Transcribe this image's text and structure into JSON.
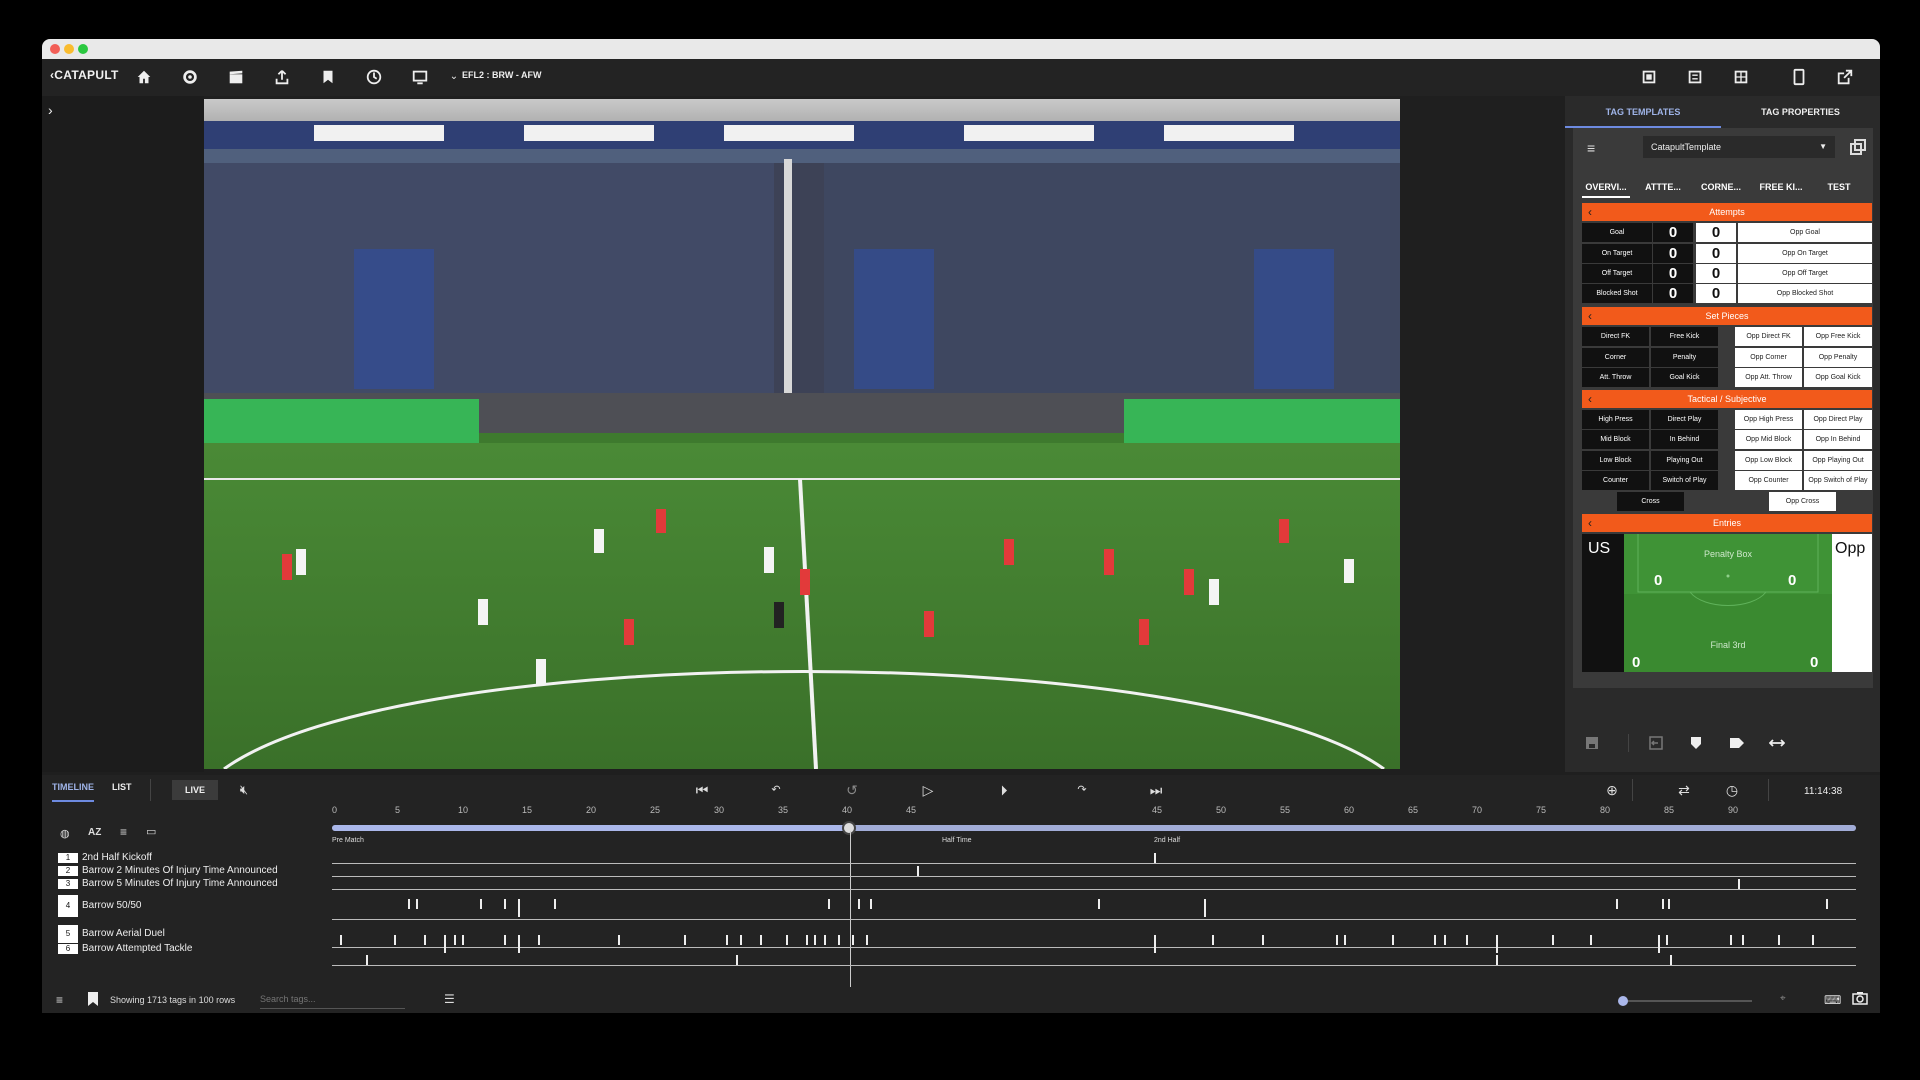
{
  "toolbar": {
    "logo": "CATAPULT",
    "match": "EFL2 : BRW - AFW",
    "icons": [
      "home-icon",
      "gear-icon",
      "clapper-icon",
      "upload-icon",
      "bookmark-icon",
      "clock-icon",
      "monitor-icon"
    ]
  },
  "right_panel": {
    "tabs": [
      "TAG TEMPLATES",
      "TAG PROPERTIES"
    ],
    "template_select": "CatapultTemplate",
    "subtabs": [
      "OVERVI...",
      "ATTTE...",
      "CORNE...",
      "FREE KI...",
      "TEST"
    ],
    "sections": {
      "attempts": "Attempts",
      "set_pieces": "Set Pieces",
      "tactical": "Tactical / Subjective",
      "entries": "Entries"
    },
    "attempts_rows": [
      {
        "label": "Goal",
        "us": "0",
        "opp": "0",
        "opp_label": "Opp Goal"
      },
      {
        "label": "On Target",
        "us": "0",
        "opp": "0",
        "opp_label": "Opp On Target"
      },
      {
        "label": "Off Target",
        "us": "0",
        "opp": "0",
        "opp_label": "Opp Off Target"
      },
      {
        "label": "Blocked Shot",
        "us": "0",
        "opp": "0",
        "opp_label": "Opp Blocked Shot"
      }
    ],
    "set_pieces_rows": [
      [
        "Direct FK",
        "Free Kick",
        "Opp Direct FK",
        "Opp Free Kick"
      ],
      [
        "Corner",
        "Penalty",
        "Opp Corner",
        "Opp Penalty"
      ],
      [
        "Att. Throw",
        "Goal Kick",
        "Opp Att. Throw",
        "Opp Goal Kick"
      ]
    ],
    "tactical_rows": [
      [
        "High Press",
        "Direct Play",
        "Opp High Press",
        "Opp Direct Play"
      ],
      [
        "Mid Block",
        "In Behind",
        "Opp Mid Block",
        "Opp In Behind"
      ],
      [
        "Low Block",
        "Playing Out",
        "Opp Low Block",
        "Opp Playing Out"
      ],
      [
        "Counter",
        "Switch of Play",
        "Opp Counter",
        "Opp Switch of Play"
      ]
    ],
    "cross": "Cross",
    "opp_cross": "Opp Cross",
    "entries": {
      "us": "US",
      "opp": "Opp",
      "penalty_box": "Penalty Box",
      "final_third": "Final 3rd",
      "pb_us": "0",
      "pb_opp": "0",
      "f3_us": "0",
      "f3_opp": "0"
    }
  },
  "bottom": {
    "tabs": [
      "TIMELINE",
      "LIST"
    ],
    "live": "LIVE",
    "clock": "11:14:38",
    "ruler": [
      "0",
      "5",
      "10",
      "15",
      "20",
      "25",
      "30",
      "35",
      "40",
      "45",
      "45",
      "50",
      "55",
      "60",
      "65",
      "70",
      "75",
      "80",
      "85",
      "90"
    ],
    "markers": [
      "Pre Match",
      "Half Time",
      "2nd Half"
    ],
    "rows": [
      {
        "num": "1",
        "label": "2nd Half Kickoff"
      },
      {
        "num": "2",
        "label": "Barrow 2 Minutes Of Injury Time Announced"
      },
      {
        "num": "3",
        "label": "Barrow 5 Minutes Of Injury Time Announced"
      },
      {
        "num": "4",
        "label": "Barrow 50/50"
      },
      {
        "num": "5",
        "label": "Barrow Aerial Duel"
      },
      {
        "num": "6",
        "label": "Barrow Attempted Tackle"
      }
    ],
    "status": "Showing 1713 tags in 100 rows",
    "search_placeholder": "Search tags..."
  },
  "colors": {
    "accent": "#f25a1b",
    "timeline_fill": "#aab7ea",
    "pitch": "#3f7d2f"
  }
}
